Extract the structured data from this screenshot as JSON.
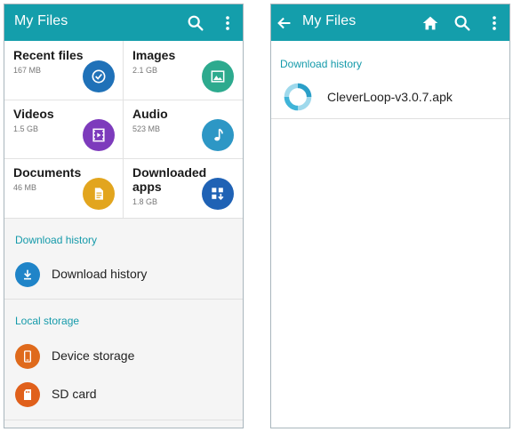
{
  "colors": {
    "appbar": "#149eab",
    "section_title": "#159aaa",
    "recent_icon": "#1f71b8",
    "images_icon": "#2daa8e",
    "videos_icon": "#7d3bbc",
    "audio_icon": "#2d97c5",
    "documents_icon": "#e2a51e",
    "downloaded_apps_icon": "#1f62b5",
    "download_history_icon": "#1f84c8",
    "device_storage_icon": "#df6a1c",
    "sd_card_icon": "#e0601b"
  },
  "left_screen": {
    "appbar": {
      "title": "My Files",
      "icons": [
        "search-icon",
        "more-vert-icon"
      ]
    },
    "categories": [
      {
        "label": "Recent files",
        "size": "167 MB",
        "icon": "clock-icon"
      },
      {
        "label": "Images",
        "size": "2.1 GB",
        "icon": "image-icon"
      },
      {
        "label": "Videos",
        "size": "1.5 GB",
        "icon": "video-icon"
      },
      {
        "label": "Audio",
        "size": "523 MB",
        "icon": "music-note-icon"
      },
      {
        "label": "Documents",
        "size": "46 MB",
        "icon": "document-icon"
      },
      {
        "label": "Downloaded\napps",
        "size": "1.8 GB",
        "icon": "apps-download-icon"
      }
    ],
    "download_history_section": {
      "title": "Download history",
      "item_label": "Download history",
      "icon": "download-icon"
    },
    "local_storage_section": {
      "title": "Local storage",
      "items": [
        {
          "label": "Device storage",
          "icon": "phone-icon"
        },
        {
          "label": "SD card",
          "icon": "sd-card-icon"
        }
      ]
    }
  },
  "right_screen": {
    "appbar": {
      "title": "My Files",
      "icons": [
        "back-arrow-icon",
        "home-icon",
        "search-icon",
        "more-vert-icon"
      ]
    },
    "section_title": "Download history",
    "files": [
      {
        "name": "CleverLoop-v3.0.7.apk",
        "icon": "cleverloop-app-icon"
      }
    ]
  }
}
